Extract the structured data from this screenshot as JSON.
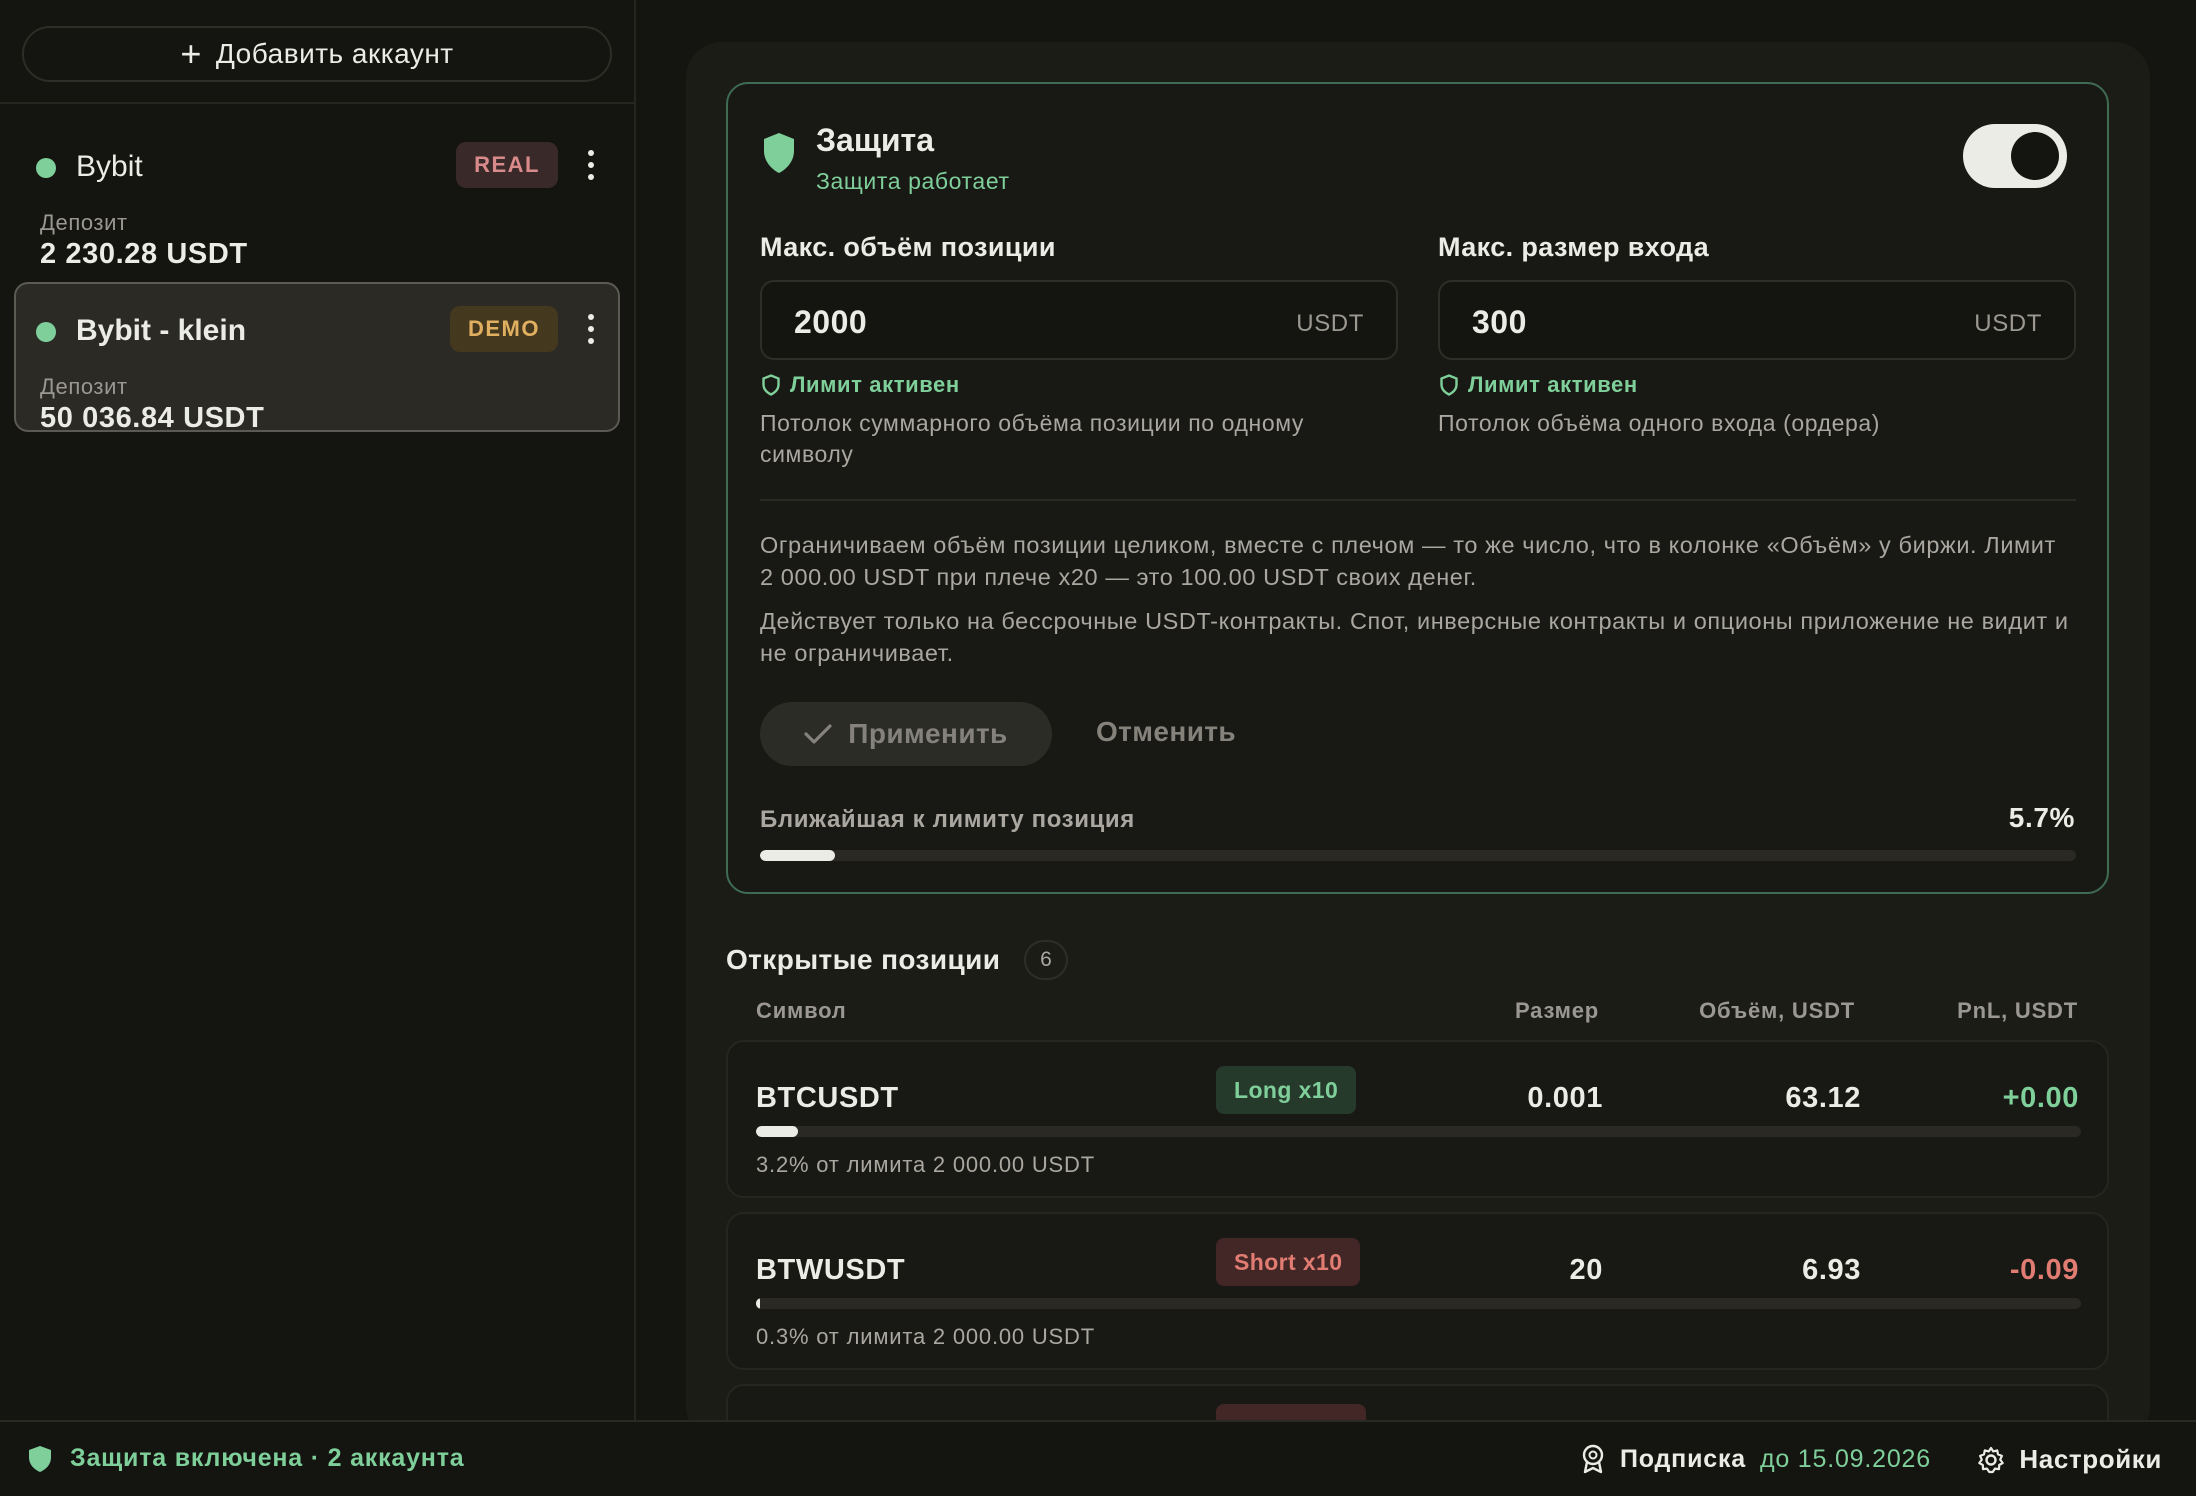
{
  "sidebar": {
    "add_account_label": "Добавить аккаунт",
    "accounts": [
      {
        "name": "Bybit",
        "badge": "REAL",
        "deposit_label": "Депозит",
        "deposit_value": "2 230.28 USDT",
        "status_color": "#7fcf9a"
      },
      {
        "name": "Bybit - klein",
        "badge": "DEMO",
        "deposit_label": "Депозит",
        "deposit_value": "50 036.84 USDT",
        "status_color": "#7fcf9a"
      }
    ]
  },
  "protection": {
    "title": "Защита",
    "status": "Защита работает",
    "enabled": true,
    "max_position": {
      "label": "Макс. объём позиции",
      "value": "2000",
      "unit": "USDT",
      "limit_status": "Лимит активен",
      "hint": "Потолок суммарного объёма позиции по одному символу"
    },
    "max_entry": {
      "label": "Макс. размер входа",
      "value": "300",
      "unit": "USDT",
      "limit_status": "Лимит активен",
      "hint": "Потолок объёма одного входа (ордера)"
    },
    "paragraph_1": "Ограничиваем объём позиции целиком, вместе с плечом — то же число, что в колонке «Объём» у биржи. Лимит 2 000.00 USDT при плече x20 — это 100.00 USDT своих денег.",
    "paragraph_2": "Действует только на бессрочные USDT-контракты. Спот, инверсные контракты и опционы приложение не видит и не ограничивает.",
    "apply_label": "Применить",
    "cancel_label": "Отменить",
    "nearest_label": "Ближайшая к лимиту позиция",
    "nearest_value": "5.7%",
    "nearest_fraction": 0.057
  },
  "positions": {
    "title": "Открытые позиции",
    "count": "6",
    "columns": {
      "symbol": "Символ",
      "size": "Размер",
      "volume": "Объём, USDT",
      "pnl": "PnL, USDT"
    },
    "rows": [
      {
        "symbol": "BTCUSDT",
        "side": "Long x10",
        "side_type": "long",
        "size": "0.001",
        "volume": "63.12",
        "pnl": "+0.00",
        "pnl_sign": "pos",
        "limit_text": "3.2% от лимита 2 000.00 USDT",
        "limit_fraction": 0.032
      },
      {
        "symbol": "BTWUSDT",
        "side": "Short x10",
        "side_type": "short",
        "size": "20",
        "volume": "6.93",
        "pnl": "-0.09",
        "pnl_sign": "neg",
        "limit_text": "0.3% от лимита 2 000.00 USDT",
        "limit_fraction": 0.003
      }
    ]
  },
  "statusbar": {
    "protection_text": "Защита включена · 2 аккаунта",
    "subscription_label": "Подписка",
    "subscription_until": "до 15.09.2026",
    "settings_label": "Настройки"
  },
  "colors": {
    "accent_green": "#7fcf9a",
    "accent_red": "#e07c72",
    "background": "#141410"
  }
}
